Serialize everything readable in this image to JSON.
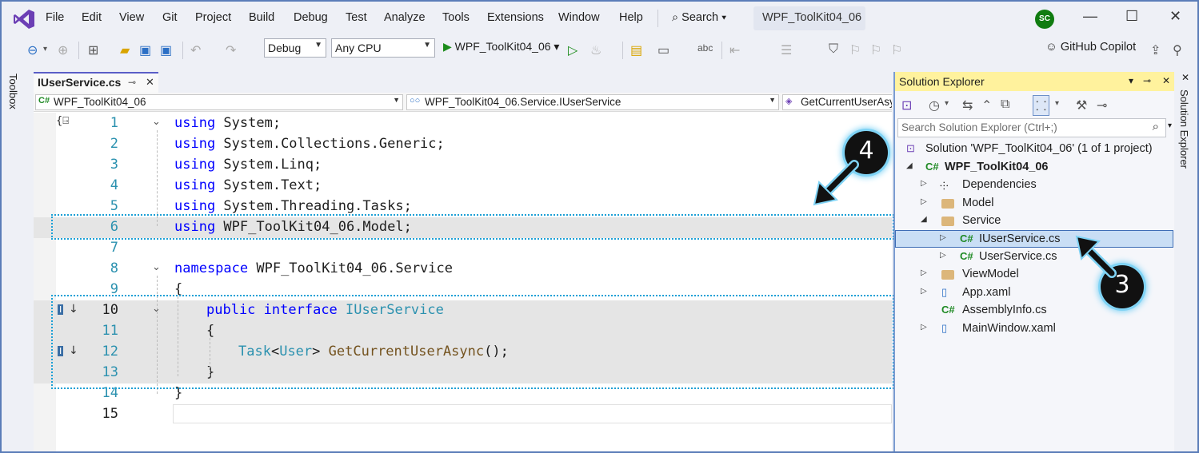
{
  "menu": {
    "items": [
      "File",
      "Edit",
      "View",
      "Git",
      "Project",
      "Build",
      "Debug",
      "Test",
      "Analyze",
      "Tools",
      "Extensions",
      "Window",
      "Help"
    ],
    "search": "Search",
    "solution_title": "WPF_ToolKit04_06",
    "avatar_initials": "SC"
  },
  "toolbar": {
    "config": "Debug",
    "platform": "Any CPU",
    "run_target": "WPF_ToolKit04_06",
    "copilot": "GitHub Copilot"
  },
  "left_strip": {
    "label": "Toolbox"
  },
  "right_strip": {
    "label": "Solution Explorer"
  },
  "editor": {
    "tab_label": "IUserService.cs",
    "nav": {
      "project": "WPF_ToolKit04_06",
      "type": "WPF_ToolKit04_06.Service.IUserService",
      "member": "GetCurrentUserAsync()"
    },
    "lines": [
      {
        "n": "1",
        "kw": "using",
        "rest": " System;"
      },
      {
        "n": "2",
        "kw": "using",
        "rest": " System.Collections.Generic;"
      },
      {
        "n": "3",
        "kw": "using",
        "rest": " System.Linq;"
      },
      {
        "n": "4",
        "kw": "using",
        "rest": " System.Text;"
      },
      {
        "n": "5",
        "kw": "using",
        "rest": " System.Threading.Tasks;"
      },
      {
        "n": "6",
        "kw": "using",
        "rest": " WPF_ToolKit04_06.Model;"
      },
      {
        "n": "7"
      },
      {
        "n": "8",
        "kw": "namespace",
        "rest": " WPF_ToolKit04_06.Service"
      },
      {
        "n": "9",
        "rest": "{"
      },
      {
        "n": "10",
        "kw": "public",
        "kw2": "interface",
        "type": "IUserService"
      },
      {
        "n": "11",
        "rest": "{"
      },
      {
        "n": "12",
        "type": "Task",
        "lt": "<",
        "type2": "User",
        "gt": ">",
        "method": "GetCurrentUserAsync",
        "tail": "();"
      },
      {
        "n": "13",
        "rest": "}"
      },
      {
        "n": "14",
        "rest": "}"
      },
      {
        "n": "15"
      }
    ]
  },
  "solution_explorer": {
    "title": "Solution Explorer",
    "search_placeholder": "Search Solution Explorer (Ctrl+;)",
    "tree": [
      {
        "label": "Solution 'WPF_ToolKit04_06' (1 of 1 project)"
      },
      {
        "label": "WPF_ToolKit04_06"
      },
      {
        "label": "Dependencies"
      },
      {
        "label": "Model"
      },
      {
        "label": "Service"
      },
      {
        "label": "IUserService.cs"
      },
      {
        "label": "UserService.cs"
      },
      {
        "label": "ViewModel"
      },
      {
        "label": "App.xaml"
      },
      {
        "label": "AssemblyInfo.cs"
      },
      {
        "label": "MainWindow.xaml"
      }
    ]
  },
  "callouts": {
    "step_a": "4",
    "step_b": "3"
  },
  "colors": {
    "keyword": "#0000FF",
    "type": "#2B91AF",
    "highlight": "#1CA0D6",
    "selection": "#C9DEF5",
    "tool_title": "#FFF29D"
  }
}
